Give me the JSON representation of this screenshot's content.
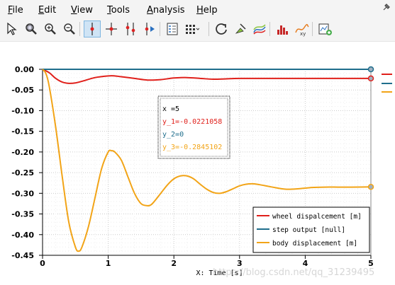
{
  "menu": [
    {
      "label": "File",
      "mnemonic": "F"
    },
    {
      "label": "Edit",
      "mnemonic": "E"
    },
    {
      "label": "View",
      "mnemonic": "V"
    },
    {
      "label": "Tools",
      "mnemonic": "T"
    },
    {
      "label": "Analysis",
      "mnemonic": "A"
    },
    {
      "label": "Help",
      "mnemonic": "H"
    }
  ],
  "toolbar": [
    {
      "name": "select-tool",
      "icon": "arrow-pointer-icon"
    },
    {
      "name": "zoom-tool",
      "icon": "zoom-area-icon"
    },
    {
      "name": "zoom-in-tool",
      "icon": "zoom-in-icon"
    },
    {
      "name": "zoom-out-tool",
      "icon": "zoom-out-icon"
    },
    {
      "name": "data-cursor-tool",
      "icon": "data-cursor-icon",
      "active": true
    },
    {
      "name": "cross-cursor-tool",
      "icon": "cross-cursor-icon"
    },
    {
      "name": "double-cursor-tool",
      "icon": "double-cursor-icon"
    },
    {
      "name": "step-cursor-tool",
      "icon": "step-cursor-icon"
    },
    {
      "name": "legend-tool",
      "icon": "legend-icon"
    },
    {
      "name": "layout-tool",
      "icon": "grid-layout-icon"
    },
    {
      "name": "refresh-tool",
      "icon": "refresh-icon"
    },
    {
      "name": "highlight-tool",
      "icon": "pin-marker-icon"
    },
    {
      "name": "curve-tool",
      "icon": "curve-style-icon"
    },
    {
      "name": "histogram-tool",
      "icon": "histogram-icon"
    },
    {
      "name": "xy-tool",
      "icon": "xy-plot-icon"
    },
    {
      "name": "new-plot-tool",
      "icon": "new-plot-icon"
    }
  ],
  "colors": {
    "wheel": "#e0201b",
    "step": "#1f6e8c",
    "body": "#f2a417"
  },
  "chart_data": {
    "type": "line",
    "xlabel": "X: Time [s]",
    "xlim": [
      0,
      5
    ],
    "ylim": [
      -0.45,
      0.0
    ],
    "xticks": [
      "0",
      "1",
      "2",
      "3",
      "4",
      "5"
    ],
    "yticks": [
      "0.00",
      "-0.05",
      "-0.10",
      "-0.15",
      "-0.20",
      "-0.25",
      "-0.30",
      "-0.35",
      "-0.40",
      "-0.45"
    ],
    "grid": true,
    "legend_position": "bottom-right",
    "series": [
      {
        "name": "wheel dispalcement [m]",
        "x": [
          0,
          0.1,
          0.2,
          0.3,
          0.4,
          0.5,
          0.6,
          0.8,
          1.0,
          1.1,
          1.2,
          1.4,
          1.6,
          1.8,
          2.0,
          2.2,
          2.4,
          2.6,
          2.8,
          3.0,
          3.5,
          4.0,
          4.5,
          5.0
        ],
        "values": [
          0,
          -0.008,
          -0.022,
          -0.031,
          -0.034,
          -0.033,
          -0.029,
          -0.02,
          -0.016,
          -0.016,
          -0.018,
          -0.022,
          -0.026,
          -0.025,
          -0.021,
          -0.02,
          -0.022,
          -0.024,
          -0.023,
          -0.022,
          -0.022,
          -0.022,
          -0.022,
          -0.0221058
        ]
      },
      {
        "name": "step output [null]",
        "x": [
          0,
          5
        ],
        "values": [
          0,
          0
        ]
      },
      {
        "name": "body displacement [m]",
        "x": [
          0,
          0.05,
          0.1,
          0.2,
          0.3,
          0.4,
          0.5,
          0.55,
          0.6,
          0.7,
          0.8,
          0.9,
          1.0,
          1.05,
          1.1,
          1.2,
          1.3,
          1.4,
          1.5,
          1.6,
          1.65,
          1.7,
          1.8,
          1.9,
          2.0,
          2.1,
          2.2,
          2.3,
          2.4,
          2.5,
          2.6,
          2.7,
          2.8,
          2.9,
          3.0,
          3.1,
          3.2,
          3.3,
          3.5,
          3.7,
          3.9,
          4.1,
          4.3,
          4.5,
          4.7,
          5.0
        ],
        "values": [
          0,
          -0.01,
          -0.04,
          -0.14,
          -0.26,
          -0.37,
          -0.43,
          -0.44,
          -0.43,
          -0.38,
          -0.31,
          -0.24,
          -0.2,
          -0.197,
          -0.2,
          -0.22,
          -0.26,
          -0.3,
          -0.325,
          -0.33,
          -0.328,
          -0.32,
          -0.3,
          -0.28,
          -0.265,
          -0.258,
          -0.258,
          -0.265,
          -0.278,
          -0.29,
          -0.298,
          -0.3,
          -0.296,
          -0.289,
          -0.282,
          -0.278,
          -0.277,
          -0.279,
          -0.285,
          -0.29,
          -0.289,
          -0.286,
          -0.285,
          -0.285,
          -0.285,
          -0.2845102
        ]
      }
    ],
    "cursor": {
      "x_label": "x  =5",
      "y1_label": "y_1=-0.0221058",
      "y2_label": "y_2=0",
      "y3_label": "y_3=-0.2845102"
    },
    "watermark": "https://blog.csdn.net/qq_31239495"
  }
}
